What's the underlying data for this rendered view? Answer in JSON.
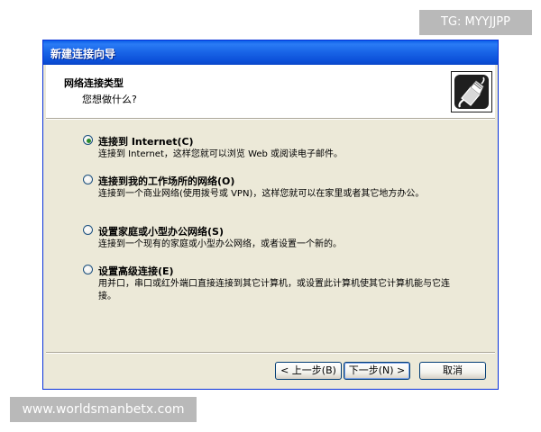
{
  "watermarks": {
    "top": "TG: MYYJJPP",
    "bottom": "www.worldsmanbetx.com"
  },
  "window": {
    "title": "新建连接向导"
  },
  "header": {
    "title": "网络连接类型",
    "subtitle": "您想做什么?",
    "icon": "network-cable-icon"
  },
  "options": [
    {
      "label": "连接到 Internet(C)",
      "description": "连接到 Internet，这样您就可以浏览 Web 或阅读电子邮件。",
      "selected": true
    },
    {
      "label": "连接到我的工作场所的网络(O)",
      "description": "连接到一个商业网络(使用拨号或 VPN)，这样您就可以在家里或者其它地方办公。",
      "selected": false
    },
    {
      "label": "设置家庭或小型办公网络(S)",
      "description": "连接到一个现有的家庭或小型办公网络，或者设置一个新的。",
      "selected": false
    },
    {
      "label": "设置高级连接(E)",
      "description": "用并口，串口或红外端口直接连接到其它计算机，或设置此计算机使其它计算机能与它连接。",
      "selected": false
    }
  ],
  "buttons": {
    "back": "< 上一步(B)",
    "next": "下一步(N) >",
    "cancel": "取消"
  }
}
